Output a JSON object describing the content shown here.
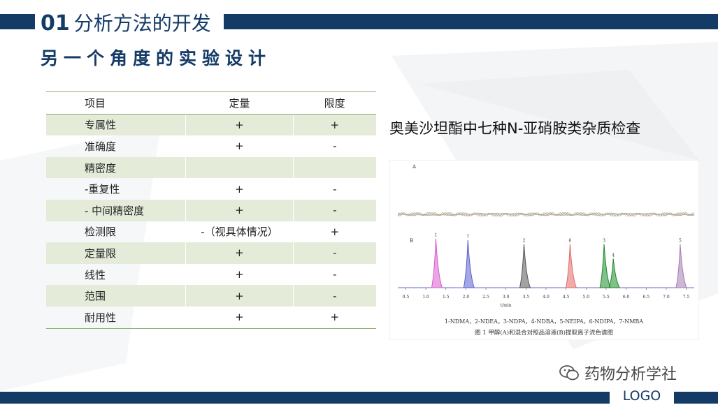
{
  "header": {
    "number": "01",
    "title": "分析方法的开发"
  },
  "subtitle": "另一个角度的实验设计",
  "table": {
    "headers": [
      "项目",
      "定量",
      "限度"
    ],
    "rows": [
      [
        "专属性",
        "+",
        "+"
      ],
      [
        "准确度",
        "+",
        "-"
      ],
      [
        "精密度",
        "",
        ""
      ],
      [
        "-重复性",
        "+",
        "-"
      ],
      [
        " - 中间精密度",
        "+",
        "-"
      ],
      [
        "检测限",
        "-（视具体情况）",
        "+"
      ],
      [
        "定量限",
        "+",
        "-"
      ],
      [
        "线性",
        "+",
        "-"
      ],
      [
        "范围",
        "+",
        "-"
      ],
      [
        "耐用性",
        "+",
        "+"
      ]
    ]
  },
  "chrom": {
    "title": "奥美沙坦酯中七种N-亚硝胺类杂质检查",
    "panel_a": "A",
    "panel_b": "B",
    "x_ticks": [
      "0.5",
      "1.0",
      "1.5",
      "2.0",
      "2.5",
      "3.0",
      "3.5",
      "4.0",
      "4.5",
      "5.0",
      "5.5",
      "6.0",
      "6.5",
      "7.0",
      "7.5"
    ],
    "x_unit": "t/min",
    "peaks": [
      {
        "label": "1",
        "t": 1.25,
        "h": 0.88,
        "color": "#d85bd0"
      },
      {
        "label": "7",
        "t": 2.05,
        "h": 0.85,
        "color": "#5b5fd0"
      },
      {
        "label": "2",
        "t": 3.45,
        "h": 0.78,
        "color": "#555555"
      },
      {
        "label": "6",
        "t": 4.6,
        "h": 0.78,
        "color": "#e06a66"
      },
      {
        "label": "3",
        "t": 5.45,
        "h": 0.78,
        "color": "#1b8a2a"
      },
      {
        "label": "4",
        "t": 5.68,
        "h": 0.52,
        "color": "#1b8a2a"
      },
      {
        "label": "5",
        "t": 7.35,
        "h": 0.78,
        "color": "#a37cb0"
      }
    ],
    "legend": "1-NDMA，2-NDEA，3-NDPA，4-NDBA，5-NEIPA，6-NDIPA，7-NMBA",
    "caption": "图 1    甲醇(A)和混合对照品溶液(B)提取离子流色谱图"
  },
  "watermark": "药物分析学社",
  "logo": "LOGO",
  "colors": {
    "brand": "#143a66",
    "table_stripe": "#e4ecd9",
    "table_rule": "#8fae6f"
  }
}
